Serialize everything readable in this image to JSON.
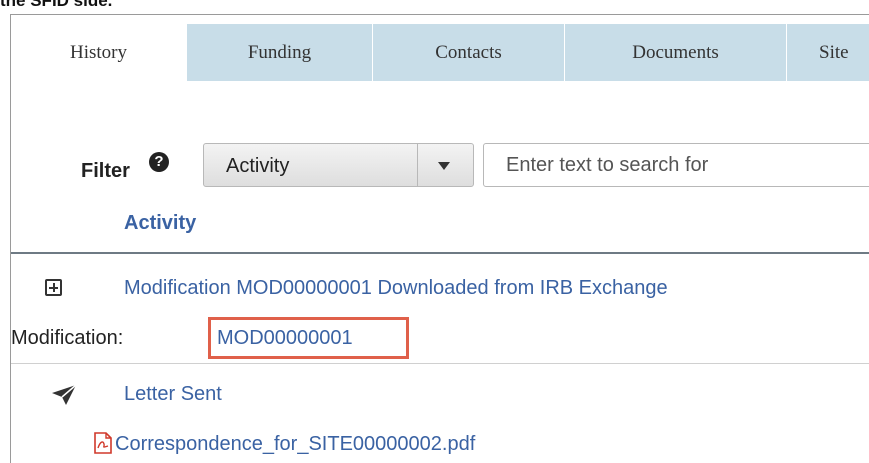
{
  "caption": "the SFID side.",
  "tabs": [
    {
      "label": "History",
      "active": true
    },
    {
      "label": "Funding",
      "active": false
    },
    {
      "label": "Contacts",
      "active": false
    },
    {
      "label": "Documents",
      "active": false
    },
    {
      "label": "Site",
      "active": false
    }
  ],
  "filter": {
    "label": "Filter",
    "help_icon": "question-circle",
    "select_value": "Activity",
    "search_placeholder": "Enter text to search for"
  },
  "column_header": "Activity",
  "rows": [
    {
      "icon": "expand-plus-icon",
      "text": "Modification MOD00000001 Downloaded from IRB Exchange",
      "detail_label": "Modification:",
      "detail_link": "MOD00000001",
      "highlight_color": "#e0604a"
    },
    {
      "icon": "paper-plane-icon",
      "text": "Letter Sent",
      "file_icon": "pdf-icon",
      "file_name": "Correspondence_for_SITE00000002.pdf"
    }
  ],
  "colors": {
    "tab_bg": "#c8dde8",
    "link": "#3a62a3",
    "highlight": "#e0604a"
  }
}
